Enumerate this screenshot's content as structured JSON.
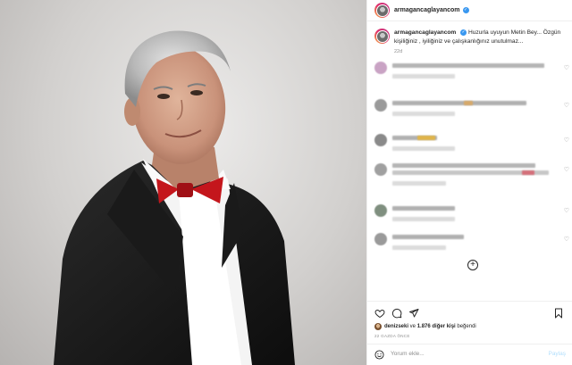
{
  "post": {
    "username": "armagancaglayancom",
    "caption": "Huzurla uyuyun Metin Bey... Özgün kişiliğiniz , iyiliğiniz ve çalışkanlığınız unutulmaz...",
    "caption_age": "22d",
    "likes_user": "denizseki",
    "likes_connector": " ve ",
    "likes_count": "1.876 diğer kişi",
    "likes_suffix": " beğendi",
    "time_ago": "22 GAZDA ÖNCE",
    "add_comment_placeholder": "Yorum ekle...",
    "share_label": "Paylaş"
  },
  "icons": {
    "verified": "verified-badge-icon",
    "heart": "heart-icon",
    "comment": "comment-icon",
    "share": "send-icon",
    "save": "bookmark-icon",
    "load_more": "plus-circle-icon",
    "emoji": "smiley-icon"
  },
  "colors": {
    "verified": "#3897f0",
    "text": "#262626",
    "muted": "#8e8e8e",
    "share_disabled": "#b2dffc",
    "bow_tie": "#c4161c"
  }
}
